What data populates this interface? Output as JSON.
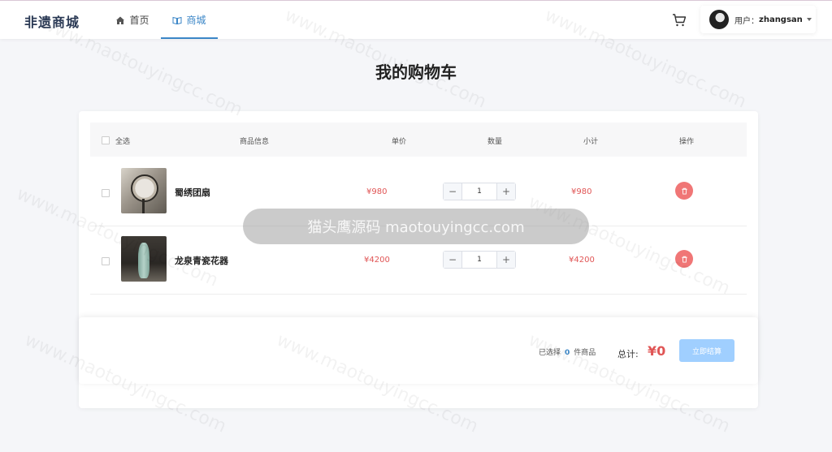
{
  "header": {
    "logo": "非遗商城",
    "nav": [
      {
        "label": "首页",
        "icon": "home-icon",
        "active": false
      },
      {
        "label": "商城",
        "icon": "book-icon",
        "active": true
      }
    ],
    "user_label": "用户：",
    "user_name": "zhangsan"
  },
  "page_title": "我的购物车",
  "table": {
    "headers": {
      "select_all": "全选",
      "info": "商品信息",
      "price": "单价",
      "qty": "数量",
      "subtotal": "小计",
      "action": "操作"
    },
    "rows": [
      {
        "name": "蜀绣团扇",
        "price": "¥980",
        "qty": "1",
        "subtotal": "¥980",
        "thumb": "fan"
      },
      {
        "name": "龙泉青瓷花器",
        "price": "¥4200",
        "qty": "1",
        "subtotal": "¥4200",
        "thumb": "vase"
      }
    ]
  },
  "footer": {
    "selected_prefix": "已选择",
    "selected_count": "0",
    "selected_suffix": "件商品",
    "total_label": "总计:",
    "total_value": "¥0",
    "checkout_label": "立即结算"
  },
  "watermark": {
    "text": "www.maotouyingcc.com",
    "pill": "猫头鹰源码 maotouyingcc.com"
  },
  "colors": {
    "accent": "#3b86c7",
    "price": "#e05555",
    "delete": "#f07676",
    "checkout_disabled": "#a0cfff"
  }
}
